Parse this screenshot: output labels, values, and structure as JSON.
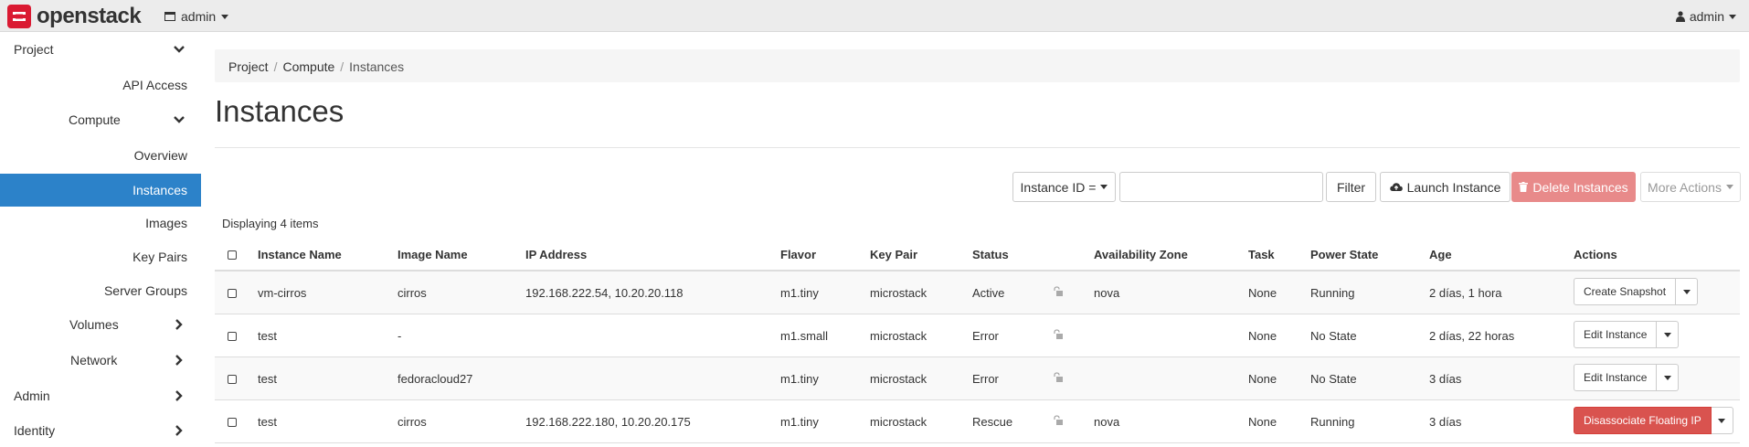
{
  "navbar": {
    "brand": "openstack",
    "project": "admin",
    "user": "admin"
  },
  "sidebar": {
    "items": [
      {
        "label": "Project",
        "chevron": "down"
      },
      {
        "label": "API Access"
      },
      {
        "label": "Compute",
        "chevron": "down"
      },
      {
        "label": "Overview"
      },
      {
        "label": "Instances",
        "active": true
      },
      {
        "label": "Images"
      },
      {
        "label": "Key Pairs"
      },
      {
        "label": "Server Groups"
      },
      {
        "label": "Volumes",
        "chevron": "right"
      },
      {
        "label": "Network",
        "chevron": "right"
      },
      {
        "label": "Admin",
        "chevron": "right"
      },
      {
        "label": "Identity",
        "chevron": "right"
      }
    ]
  },
  "breadcrumb": {
    "items": [
      "Project",
      "Compute",
      "Instances"
    ],
    "sep": "/"
  },
  "page": {
    "title": "Instances"
  },
  "toolbar": {
    "filter_field": "Instance ID =",
    "search_value": "",
    "filter_label": "Filter",
    "launch_label": "Launch Instance",
    "delete_label": "Delete Instances",
    "more_label": "More Actions"
  },
  "table": {
    "count_text": "Displaying 4 items",
    "headers": [
      "Instance Name",
      "Image Name",
      "IP Address",
      "Flavor",
      "Key Pair",
      "Status",
      "Availability Zone",
      "Task",
      "Power State",
      "Age",
      "Actions"
    ],
    "rows": [
      {
        "name": "vm-cirros",
        "image": "cirros",
        "ip": "192.168.222.54, 10.20.20.118",
        "flavor": "m1.tiny",
        "keypair": "microstack",
        "status": "Active",
        "az": "nova",
        "task": "None",
        "power": "Running",
        "age": "2 días, 1 hora",
        "action": "Create Snapshot",
        "action_style": "default"
      },
      {
        "name": "test",
        "image": "-",
        "ip": "",
        "flavor": "m1.small",
        "keypair": "microstack",
        "status": "Error",
        "az": "",
        "task": "None",
        "power": "No State",
        "age": "2 días, 22 horas",
        "action": "Edit Instance",
        "action_style": "default"
      },
      {
        "name": "test",
        "image": "fedoracloud27",
        "ip": "",
        "flavor": "m1.tiny",
        "keypair": "microstack",
        "status": "Error",
        "az": "",
        "task": "None",
        "power": "No State",
        "age": "3 días",
        "action": "Edit Instance",
        "action_style": "default"
      },
      {
        "name": "test",
        "image": "cirros",
        "ip": "192.168.222.180, 10.20.20.175",
        "flavor": "m1.tiny",
        "keypair": "microstack",
        "status": "Rescue",
        "az": "nova",
        "task": "None",
        "power": "Running",
        "age": "3 días",
        "action": "Disassociate Floating IP",
        "action_style": "danger"
      }
    ]
  },
  "colors": {
    "accent": "#2c82c9",
    "link": "#2a7fc0",
    "danger": "#d9534f",
    "brand_red": "#da1a32"
  }
}
